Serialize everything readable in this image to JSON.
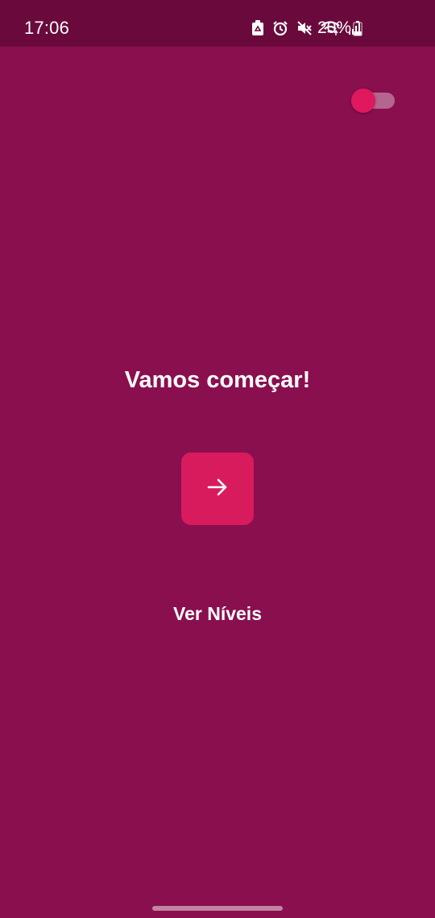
{
  "status_bar": {
    "time": "17:06",
    "battery_percent": "20%",
    "icons": [
      "recycle-icon",
      "alarm-icon",
      "mute-icon",
      "wifi-icon",
      "signal-icon",
      "battery-icon"
    ]
  },
  "theme_toggle": {
    "state": "on",
    "thumb_color": "#e0195f"
  },
  "main": {
    "title": "Vamos começar!",
    "start_button_icon": "arrow-right-icon",
    "levels_link": "Ver Níveis"
  },
  "colors": {
    "background": "#8a0f4e",
    "status_bar": "#6a0a3c",
    "accent": "#d81b5c",
    "text": "#ffffff"
  }
}
